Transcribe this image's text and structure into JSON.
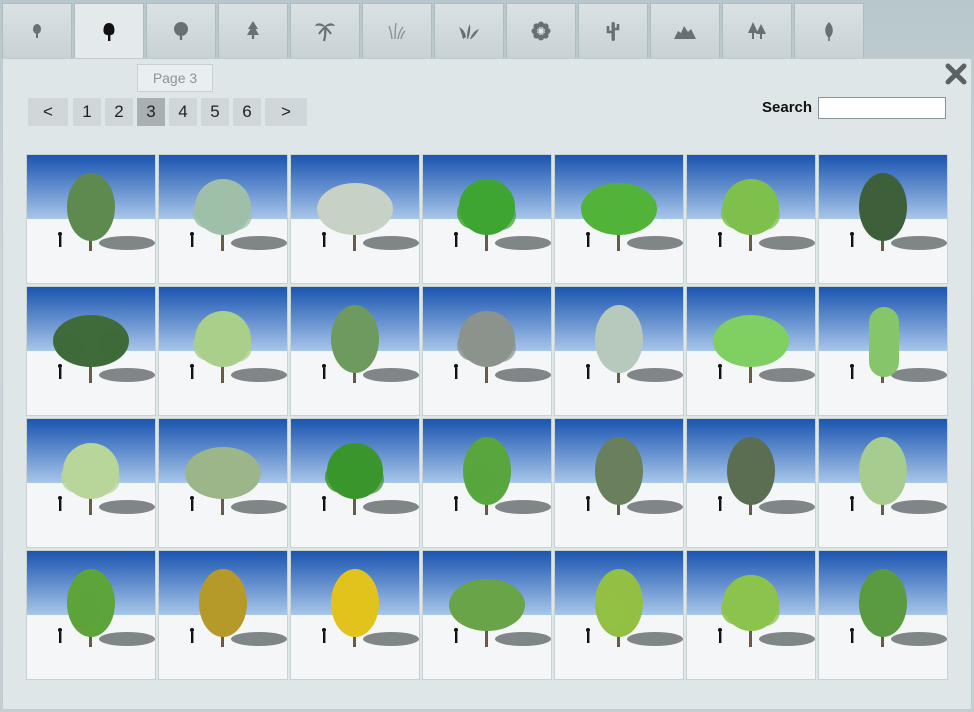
{
  "tabs": [
    {
      "icon": "small-tree-icon",
      "active": false
    },
    {
      "icon": "broadleaf-tree-icon",
      "active": true
    },
    {
      "icon": "round-tree-icon",
      "active": false
    },
    {
      "icon": "conifer-icon",
      "active": false
    },
    {
      "icon": "palm-tree-icon",
      "active": false
    },
    {
      "icon": "grass-icon",
      "active": false
    },
    {
      "icon": "shrub-icon",
      "active": false
    },
    {
      "icon": "flower-icon",
      "active": false
    },
    {
      "icon": "cactus-icon",
      "active": false
    },
    {
      "icon": "rocks-icon",
      "active": false
    },
    {
      "icon": "forest-icon",
      "active": false
    },
    {
      "icon": "leaf-icon",
      "active": false
    }
  ],
  "tooltip": "Page 3",
  "pager": {
    "prev": "<",
    "next": ">",
    "pages": [
      "1",
      "2",
      "3",
      "4",
      "5",
      "6"
    ],
    "current": "3"
  },
  "search": {
    "label": "Search",
    "value": ""
  },
  "colors": {
    "sky_top": "#1a55b0",
    "sky_bottom": "#a9c6ea",
    "ground": "#f4f6f7"
  },
  "thumbnails": [
    {
      "color": "#5f8a4f",
      "shape": "oval"
    },
    {
      "color": "#9fbfa8",
      "shape": "round"
    },
    {
      "color": "#c8d2c4",
      "shape": "wide"
    },
    {
      "color": "#3fa532",
      "shape": "round"
    },
    {
      "color": "#52b33a",
      "shape": "wide"
    },
    {
      "color": "#7fc04c",
      "shape": "round"
    },
    {
      "color": "#3d5f3a",
      "shape": "oval"
    },
    {
      "color": "#3f6a3a",
      "shape": "wide"
    },
    {
      "color": "#a9cf8a",
      "shape": "round"
    },
    {
      "color": "#6e9a5f",
      "shape": "oval"
    },
    {
      "color": "#8c938c",
      "shape": "round"
    },
    {
      "color": "#b7c8bd",
      "shape": "oval"
    },
    {
      "color": "#7fcf62",
      "shape": "wide"
    },
    {
      "color": "#86c56a",
      "shape": "column"
    },
    {
      "color": "#b9d69a",
      "shape": "round"
    },
    {
      "color": "#9cb589",
      "shape": "wide"
    },
    {
      "color": "#3a962c",
      "shape": "round"
    },
    {
      "color": "#58a63d",
      "shape": "oval"
    },
    {
      "color": "#6a7f5c",
      "shape": "oval"
    },
    {
      "color": "#5c6e52",
      "shape": "oval"
    },
    {
      "color": "#a7cc8f",
      "shape": "oval"
    },
    {
      "color": "#5da43a",
      "shape": "oval"
    },
    {
      "color": "#b59a2a",
      "shape": "oval"
    },
    {
      "color": "#e2c21c",
      "shape": "oval"
    },
    {
      "color": "#6aa449",
      "shape": "wide"
    },
    {
      "color": "#93c044",
      "shape": "oval"
    },
    {
      "color": "#8cc34c",
      "shape": "round"
    },
    {
      "color": "#5a9a40",
      "shape": "oval"
    }
  ]
}
